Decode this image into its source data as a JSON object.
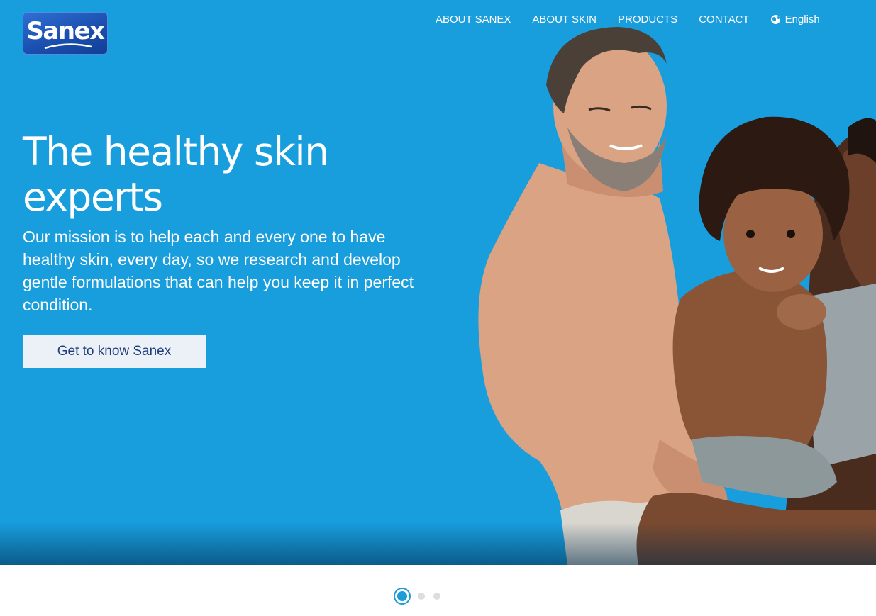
{
  "brand": {
    "name": "Sanex"
  },
  "nav": {
    "items": [
      {
        "label": "ABOUT SANEX"
      },
      {
        "label": "ABOUT SKIN"
      },
      {
        "label": "PRODUCTS"
      },
      {
        "label": "CONTACT"
      }
    ],
    "language": {
      "label": "English",
      "icon": "globe-icon"
    }
  },
  "hero": {
    "title": "The healthy skin experts",
    "description": "Our mission is to help each and every one to have healthy skin, every day, so we research and develop gentle formulations that can help you keep it in perfect condition.",
    "cta_label": "Get to know Sanex"
  },
  "carousel": {
    "total_slides": 3,
    "active_index": 1
  },
  "colors": {
    "hero_bg": "#189ddd",
    "cta_bg": "#ecf1f8",
    "cta_text": "#1c3d7a",
    "logo_bg": "#1b4fb0"
  }
}
